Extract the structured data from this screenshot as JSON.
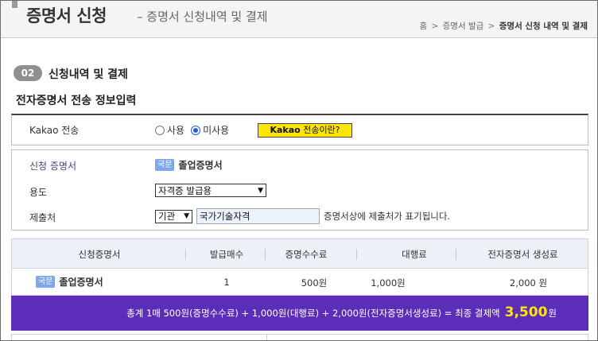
{
  "header": {
    "title": "증명서 신청",
    "subtitle": "– 증명서 신청내역 및 결제",
    "breadcrumb": [
      "홈",
      "증명서 발급",
      "증명서 신청 내역 및 결제"
    ]
  },
  "section": {
    "step_number": "02",
    "step_title": "신청내역 및 결제",
    "subheading": "전자증명서 전송 정보입력"
  },
  "kakao": {
    "label": "Kakao 전송",
    "options": [
      "사용",
      "미사용"
    ],
    "selected": "미사용",
    "info_button_bold": "Kakao",
    "info_button_rest": " 전송이란?"
  },
  "certificate": {
    "label_cert": "신청 증명서",
    "badge": "국문",
    "cert_name": "졸업증명서",
    "label_purpose": "용도",
    "purpose_selected": "자격증 발급용",
    "label_submit": "제출처",
    "submit_type_selected": "기관",
    "submit_value": "국가기술자격",
    "submit_note": "증명서상에 제출처가 표기됩니다."
  },
  "table": {
    "headers": [
      "신청증명서",
      "발급매수",
      "증명수수료",
      "대행료",
      "전자증명서 생성료"
    ],
    "row": {
      "badge": "국문",
      "cert_name": "졸업증명서",
      "count": "1",
      "fee": "500원",
      "agency_fee": "1,000원",
      "ecert_fee": "2,000 원"
    }
  },
  "total": {
    "summary": "총계 1매 500원(증명수수료) + 1,000원(대행료) + 2,000원(전자증명서생성료) = 최종 결제액",
    "amount": "3,500",
    "unit": "원"
  },
  "colors": {
    "total_bar": "#5b2db8",
    "total_amount": "#ffe31a",
    "kakao_button": "#ffe600",
    "badge": "#7fa8e8"
  }
}
